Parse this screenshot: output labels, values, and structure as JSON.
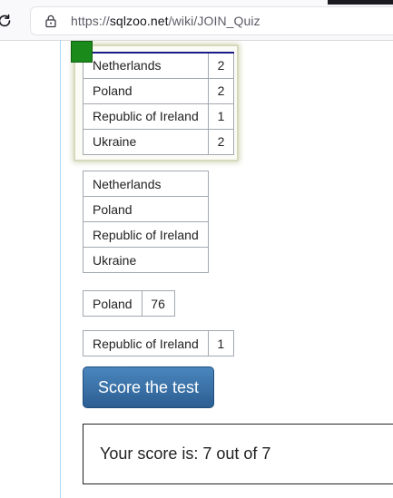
{
  "browser": {
    "url_prefix": "https://",
    "url_host": "sqlzoo.net",
    "url_path": "/wiki/JOIN_Quiz",
    "reload_icon": "reload-icon",
    "lock_icon": "lock-icon"
  },
  "quiz": {
    "selected_answer": {
      "status_icon": "check-icon",
      "status_color": "#1a8a1a",
      "rows": [
        {
          "name": "Netherlands",
          "count": "2"
        },
        {
          "name": "Poland",
          "count": "2"
        },
        {
          "name": "Republic of Ireland",
          "count": "1"
        },
        {
          "name": "Ukraine",
          "count": "2"
        }
      ]
    },
    "option_countries": {
      "rows": [
        "Netherlands",
        "Poland",
        "Republic of Ireland",
        "Ukraine"
      ]
    },
    "option_poland": {
      "name": "Poland",
      "value": "76"
    },
    "option_ireland": {
      "name": "Republic of Ireland",
      "value": "1"
    },
    "score_button_label": "Score the test",
    "score_text": "Your score is: 7 out of 7",
    "button_color": "#2c5e92"
  }
}
